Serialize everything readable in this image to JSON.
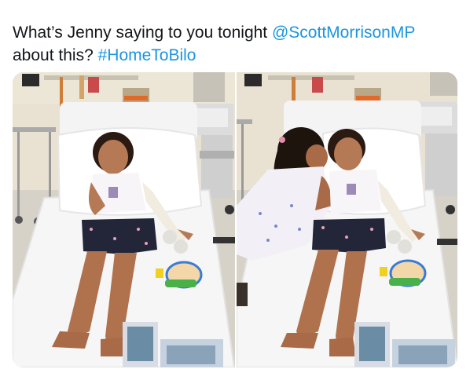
{
  "tweet": {
    "text_part1": "What’s Jenny saying to you tonight ",
    "mention": "@ScottMorrisonMP",
    "text_part2": " about this? ",
    "hashtag": "#HomeToBilo"
  },
  "media": {
    "photos": [
      {
        "subject": "girl-lying-on-hospital-bed"
      },
      {
        "subject": "sister-kissing-girl-on-hospital-bed"
      }
    ]
  },
  "colors": {
    "text": "#14171a",
    "link": "#1b95e0",
    "background": "#ffffff"
  }
}
